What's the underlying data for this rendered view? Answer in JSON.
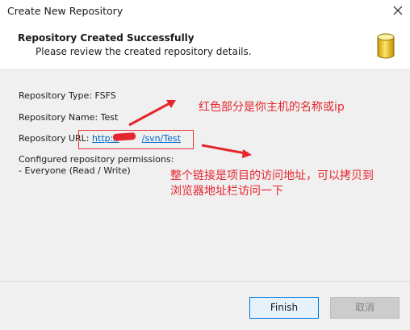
{
  "window": {
    "title": "Create New Repository",
    "close_icon": "close-icon"
  },
  "header": {
    "title": "Repository Created Successfully",
    "subtitle": "Please review the created repository details.",
    "icon": "database-icon"
  },
  "details": {
    "type_label": "Repository Type: FSFS",
    "name_label": "Repository Name: Test",
    "url_label": "Repository URL:",
    "url_prefix": "http://",
    "url_suffix": "/svn/Test",
    "permissions_label": "Configured repository permissions:",
    "permissions_value": "- Everyone (Read / Write)"
  },
  "annotations": {
    "note_host": "红色部分是你主机的名称或ip",
    "note_link_line1": "整个链接是项目的访问地址，可以拷贝到",
    "note_link_line2": "浏览器地址栏访问一下",
    "color": "#e5262e"
  },
  "buttons": {
    "finish": "Finish",
    "cancel": "取消"
  }
}
